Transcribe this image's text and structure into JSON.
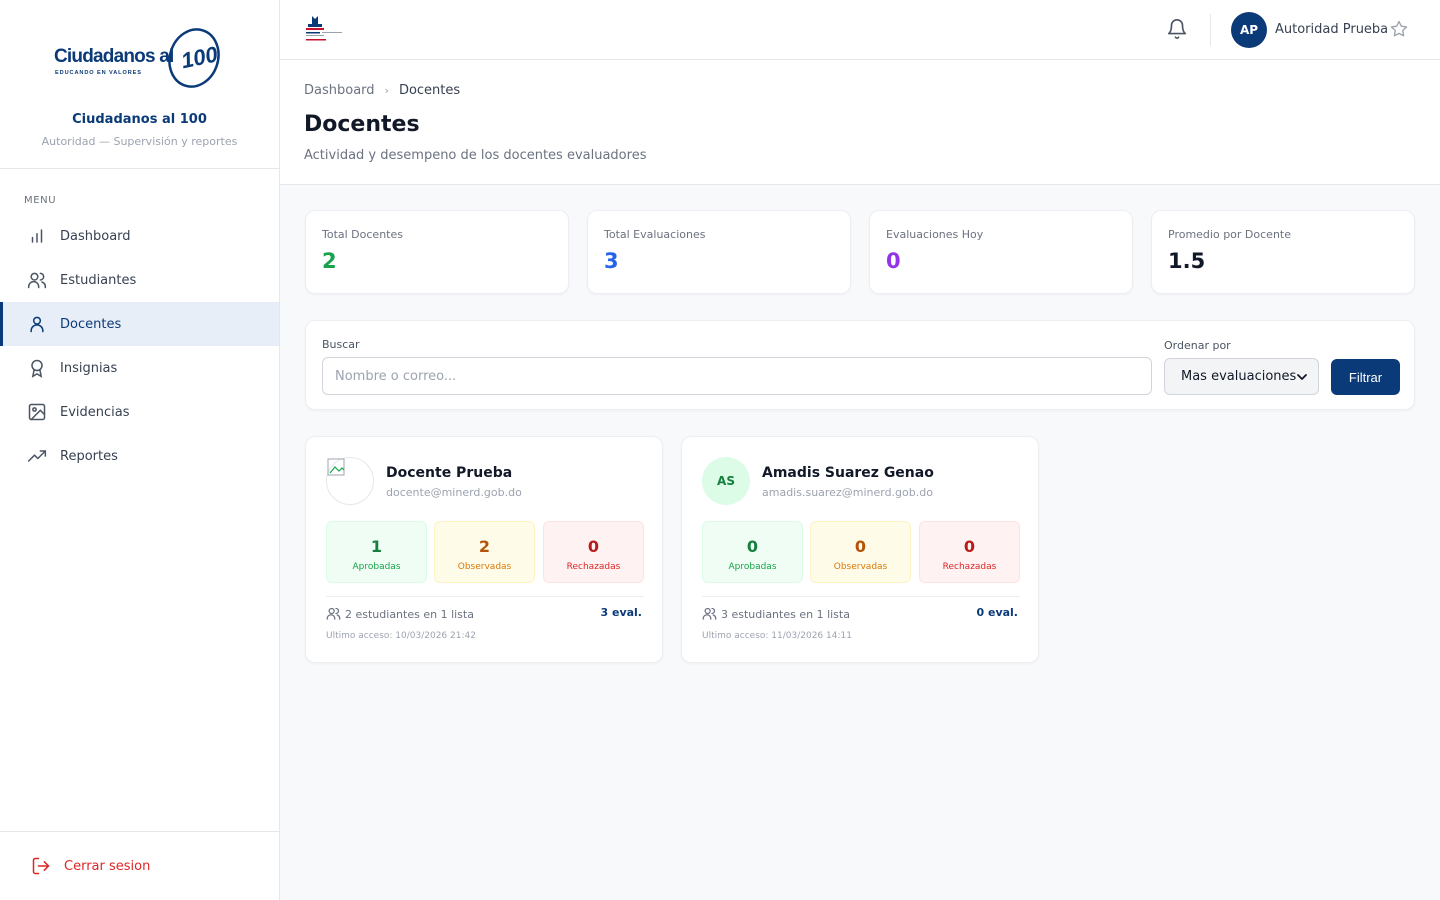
{
  "brand": {
    "logo_text": "Ciudadanos al",
    "logo_number": "100",
    "logo_tagline": "EDUCANDO EN VALORES",
    "name": "Ciudadanos al 100",
    "subtitle": "Autoridad — Supervisión y reportes"
  },
  "sidebar": {
    "menu_label": "MENU",
    "items": [
      {
        "label": "Dashboard",
        "icon": "bar-chart-icon"
      },
      {
        "label": "Estudiantes",
        "icon": "users-icon"
      },
      {
        "label": "Docentes",
        "icon": "user-icon",
        "active": true
      },
      {
        "label": "Insignias",
        "icon": "award-icon"
      },
      {
        "label": "Evidencias",
        "icon": "image-icon"
      },
      {
        "label": "Reportes",
        "icon": "trending-up-icon"
      }
    ],
    "logout_label": "Cerrar sesion"
  },
  "topbar": {
    "user_initials": "AP",
    "user_name": "Autoridad Prueba"
  },
  "header": {
    "breadcrumb": [
      "Dashboard",
      "Docentes"
    ],
    "title": "Docentes",
    "subtitle": "Actividad y desempeno de los docentes evaluadores"
  },
  "stats": [
    {
      "label": "Total Docentes",
      "value": "2",
      "color": "#16a34a"
    },
    {
      "label": "Total Evaluaciones",
      "value": "3",
      "color": "#2563eb"
    },
    {
      "label": "Evaluaciones Hoy",
      "value": "0",
      "color": "#9333ea"
    },
    {
      "label": "Promedio por Docente",
      "value": "1.5",
      "color": "#111827"
    }
  ],
  "filters": {
    "search_label": "Buscar",
    "search_placeholder": "Nombre o correo...",
    "sort_label": "Ordenar por",
    "sort_value": "Mas evaluaciones",
    "filter_button": "Filtrar"
  },
  "teachers": [
    {
      "name": "Docente Prueba",
      "email": "docente@minerd.gob.do",
      "avatar": "image",
      "initials": "",
      "approved": "1",
      "observed": "2",
      "rejected": "0",
      "approved_label": "Aprobadas",
      "observed_label": "Observadas",
      "rejected_label": "Rechazadas",
      "students": "2 estudiantes en 1 lista",
      "evals": "3 eval.",
      "last_access": "Ultimo acceso: 10/03/2026 21:42"
    },
    {
      "name": "Amadis Suarez Genao",
      "email": "amadis.suarez@minerd.gob.do",
      "avatar": "initials",
      "initials": "AS",
      "approved": "0",
      "observed": "0",
      "rejected": "0",
      "approved_label": "Aprobadas",
      "observed_label": "Observadas",
      "rejected_label": "Rechazadas",
      "students": "3 estudiantes en 1 lista",
      "evals": "0 eval.",
      "last_access": "Ultimo acceso: 11/03/2026 14:11"
    }
  ],
  "colors": {
    "brand": "#0b3a78",
    "danger": "#dc2626"
  }
}
